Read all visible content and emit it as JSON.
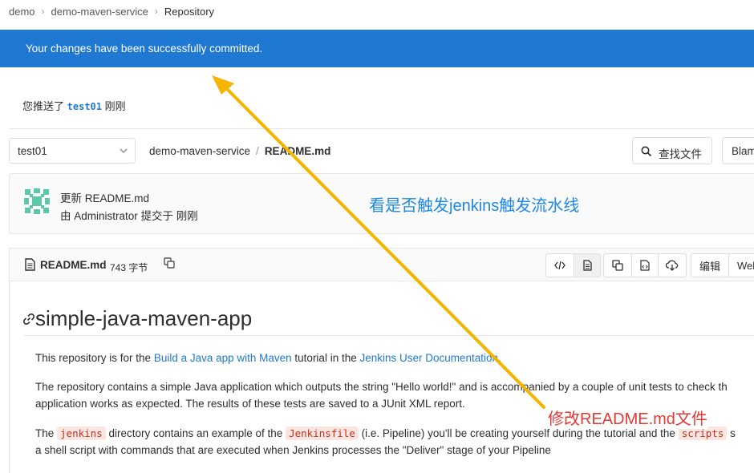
{
  "breadcrumb": [
    "demo",
    "demo-maven-service",
    "Repository"
  ],
  "flash": {
    "message": "Your changes have been successfully committed."
  },
  "push_notice": {
    "prefix": "您推送了",
    "branch": "test01",
    "suffix": "刚刚"
  },
  "tree": {
    "branch": "test01",
    "path_project": "demo-maven-service",
    "path_sep": "/",
    "path_file": "README.md",
    "find_file_label": "查找文件",
    "blame_label": "Blam"
  },
  "commit": {
    "title": "更新 README.md",
    "meta": "由 Administrator 提交于 刚刚"
  },
  "annotations": {
    "blue_note": "看是否触发jenkins触发流水线",
    "red_note": "修改README.md文件",
    "blue_color": "#1e88e5",
    "red_color": "#e53935",
    "arrow_color": "#f5b400"
  },
  "file_header": {
    "name": "README.md",
    "size": "743 字节",
    "edit_label": "编辑",
    "web_ide_label": "Web"
  },
  "readme": {
    "heading": "simple-java-maven-app",
    "p1": {
      "t1": "This repository is for the ",
      "link1": "Build a Java app with Maven",
      "t2": " tutorial in the ",
      "link2": "Jenkins User Documentation",
      "t3": "."
    },
    "p2": {
      "line1": "The repository contains a simple Java application which outputs the string \"Hello world!\" and is accompanied by a couple of unit tests to check th",
      "line2": "application works as expected. The results of these tests are saved to a JUnit XML report."
    },
    "p3": {
      "t1": "The ",
      "code1": "jenkins",
      "t2": " directory contains an example of the ",
      "code2": "Jenkinsfile",
      "t3": " (i.e. Pipeline) you'll be creating yourself during the tutorial and the ",
      "code3": "scripts",
      "t4": " s",
      "line2": "a shell script with commands that are executed when Jenkins processes the \"Deliver\" stage of your Pipeline"
    }
  },
  "colors": {
    "flash_bg": "#1f78d1",
    "link": "#1f78d1"
  }
}
